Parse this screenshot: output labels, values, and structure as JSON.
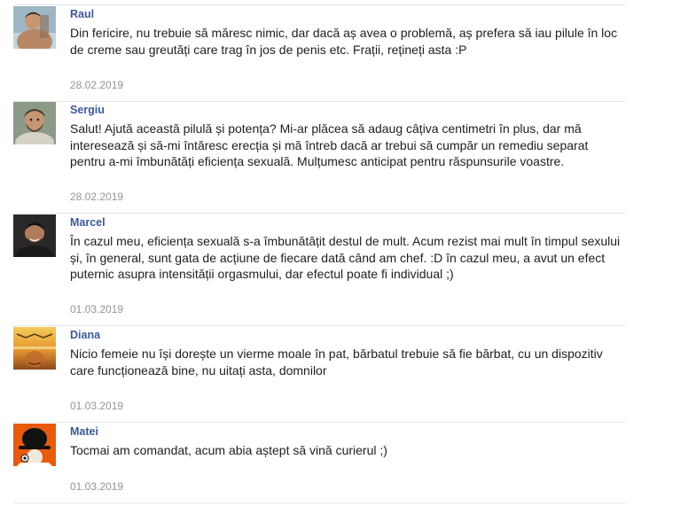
{
  "comments": [
    {
      "author": "Raul",
      "avatar": "man-shirtless-avatar",
      "text": "Din fericire, nu trebuie să măresc nimic, dar dacă aș avea o problemă, aș prefera să iau pilule în loc de creme sau greutăți care trag în jos de penis etc. Frații, rețineți asta :P",
      "date": "28.02.2019"
    },
    {
      "author": "Sergiu",
      "avatar": "bearded-man-avatar",
      "text": "Salut! Ajută această pilulă și potența? Mi-ar plăcea să adaug câțiva centimetri în plus, dar mă interesează și să-mi întăresc erecția și mă întreb dacă ar trebui să cumpăr un remediu separat pentru a-mi îmbunătăți eficiența sexuală. Mulțumesc anticipat pentru răspunsurile voastre.",
      "date": "28.02.2019"
    },
    {
      "author": "Marcel",
      "avatar": "man-dark-avatar",
      "text": "În cazul meu, eficiența sexuală s-a îmbunătățit destul de mult. Acum rezist mai mult în timpul sexului și, în general, sunt gata de acțiune de fiecare dată când am chef. :D în cazul meu, a avut un efect puternic asupra intensității orgasmului, dar efectul poate fi individual ;)",
      "date": "01.03.2019"
    },
    {
      "author": "Diana",
      "avatar": "sunset-face-avatar",
      "text": "Nicio femeie nu își dorește un vierme moale în pat, bărbatul trebuie să fie bărbat, cu un dispozitiv care funcționează bine, nu uitați asta, domnilor",
      "date": "01.03.2019"
    },
    {
      "author": "Matei",
      "avatar": "bowler-hat-avatar",
      "text": "Tocmai am comandat, acum abia aștept să vină curierul ;)",
      "date": "01.03.2019"
    }
  ],
  "colors": {
    "author": "#3b5998",
    "text": "#1c1e21",
    "date": "#90949c",
    "divider": "#e3e5ea"
  }
}
